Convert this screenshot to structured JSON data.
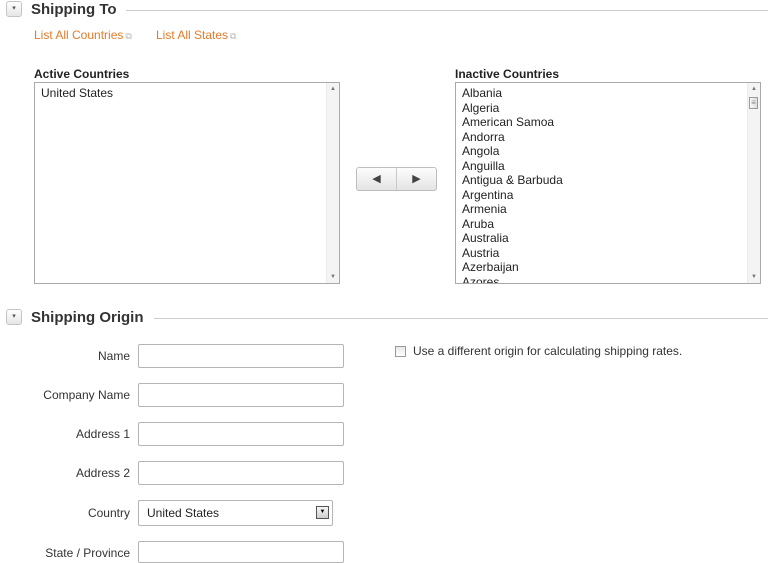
{
  "shipping_to": {
    "title": "Shipping To",
    "collapse_glyph": "▾",
    "links": [
      {
        "label": "List All Countries",
        "icon": "external-link-icon",
        "glyph": "⧉"
      },
      {
        "label": "List All States",
        "icon": "external-link-icon",
        "glyph": "⧉"
      }
    ],
    "active_label": "Active Countries",
    "active_countries": [
      "United States"
    ],
    "inactive_label": "Inactive Countries",
    "inactive_countries": [
      "Albania",
      "Algeria",
      "American Samoa",
      "Andorra",
      "Angola",
      "Anguilla",
      "Antigua & Barbuda",
      "Argentina",
      "Armenia",
      "Aruba",
      "Australia",
      "Austria",
      "Azerbaijan",
      "Azores"
    ],
    "move_left_glyph": "◀",
    "move_right_glyph": "▶",
    "scroll_up_glyph": "▲",
    "scroll_down_glyph": "▼",
    "thumb_glyph": "≡"
  },
  "shipping_origin": {
    "title": "Shipping Origin",
    "collapse_glyph": "▾",
    "name_label": "Name",
    "name_value": "",
    "company_label": "Company Name",
    "company_value": "",
    "address1_label": "Address 1",
    "address1_value": "",
    "address2_label": "Address 2",
    "address2_value": "",
    "country_label": "Country",
    "country_value": "United States",
    "country_arrow_glyph": "▼",
    "state_label": "State / Province",
    "state_value": "",
    "different_origin_checked": false,
    "different_origin_label": "Use a different origin for calculating shipping rates."
  },
  "colors": {
    "link": "#e57a2a",
    "border": "#aaaaaa",
    "rule": "#cccccc"
  }
}
